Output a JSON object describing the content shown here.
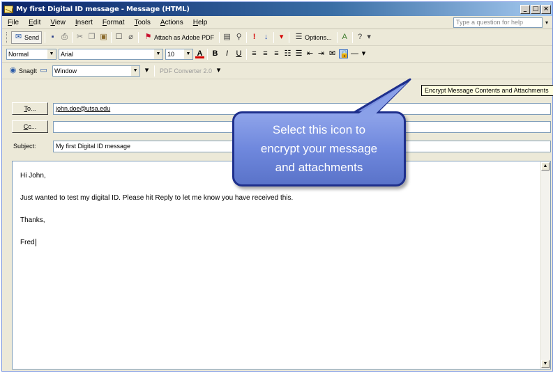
{
  "window": {
    "title": "My first Digital ID message - Message (HTML)",
    "controls": [
      "_",
      "□",
      "×"
    ]
  },
  "menu": {
    "items": [
      "File",
      "Edit",
      "View",
      "Insert",
      "Format",
      "Tools",
      "Actions",
      "Help"
    ],
    "help_placeholder": "Type a question for help"
  },
  "toolbar1": {
    "send_label": "Send",
    "attach_pdf_label": "Attach as Adobe PDF",
    "options_label": "Options..."
  },
  "toolbar2": {
    "style": "Normal",
    "font": "Arial",
    "size": "10"
  },
  "toolbar3": {
    "snagit_label": "SnagIt",
    "window_label": "Window",
    "pdf_converter": "PDF Converter 2.0"
  },
  "tooltip": "Encrypt Message Contents and Attachments",
  "addressing": {
    "to_label": "To...",
    "to_value": "john.doe@utsa.edu",
    "cc_label": "Cc...",
    "cc_value": "",
    "subject_label": "Subject:",
    "subject_value": "My first Digital ID message"
  },
  "message_body": {
    "lines": [
      "Hi John,",
      "Just wanted to test my digital ID.  Please hit Reply to let me know you have received this.",
      "Thanks,",
      "Fred"
    ]
  },
  "callout": {
    "text_lines": [
      "Select this icon to",
      "encrypt your message",
      "and attachments"
    ]
  },
  "colors": {
    "titlebar": "#0a246a",
    "callout_fill": "#6f88dd",
    "callout_border": "#1e2f8c"
  }
}
